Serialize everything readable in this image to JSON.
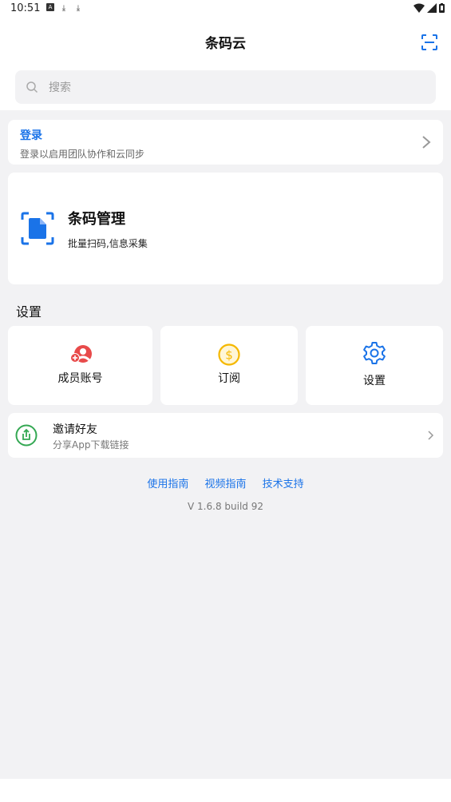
{
  "status_bar": {
    "time": "10:51"
  },
  "header": {
    "title": "条码云"
  },
  "search": {
    "placeholder": "搜索"
  },
  "login": {
    "title": "登录",
    "subtitle": "登录以启用团队协作和云同步"
  },
  "barcode": {
    "title": "条码管理",
    "subtitle": "批量扫码,信息采集"
  },
  "settings": {
    "section_title": "设置",
    "tiles": [
      {
        "label": "成员账号",
        "icon": "member-account-icon",
        "color": "#e84a4a"
      },
      {
        "label": "订阅",
        "icon": "dollar-coin-icon",
        "color": "#f5b800"
      },
      {
        "label": "设置",
        "icon": "gear-icon",
        "color": "#1a73e8"
      }
    ]
  },
  "invite": {
    "title": "邀请好友",
    "subtitle": "分享App下载链接",
    "icon_color": "#34a853"
  },
  "links": [
    "使用指南",
    "视频指南",
    "技术支持"
  ],
  "version": "V 1.6.8 build 92",
  "colors": {
    "accent": "#1a73e8",
    "background": "#f2f2f4"
  }
}
